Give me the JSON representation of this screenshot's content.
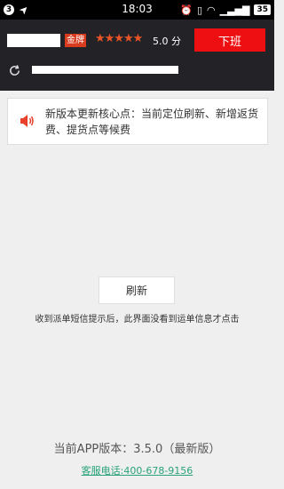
{
  "status_bar": {
    "notification_count": "3",
    "time": "18:03",
    "battery": "35"
  },
  "header": {
    "badge": "金牌",
    "stars": "★★★★★",
    "rating": "5.0 分",
    "offwork_button": "下班"
  },
  "notice": {
    "text": "新版本更新核心点：当前定位刷新、新增返货费、提货点等候费"
  },
  "main": {
    "refresh_button": "刷新",
    "hint": "收到派单短信提示后，此界面没看到运单信息才点击"
  },
  "footer": {
    "version": "当前APP版本：3.5.0（最新版）",
    "service_phone": "客服电话:400-678-9156"
  },
  "colors": {
    "header_bg": "#222227",
    "accent_red": "#ee0f12",
    "star_orange": "#e85426",
    "link_green": "#29a27a"
  }
}
